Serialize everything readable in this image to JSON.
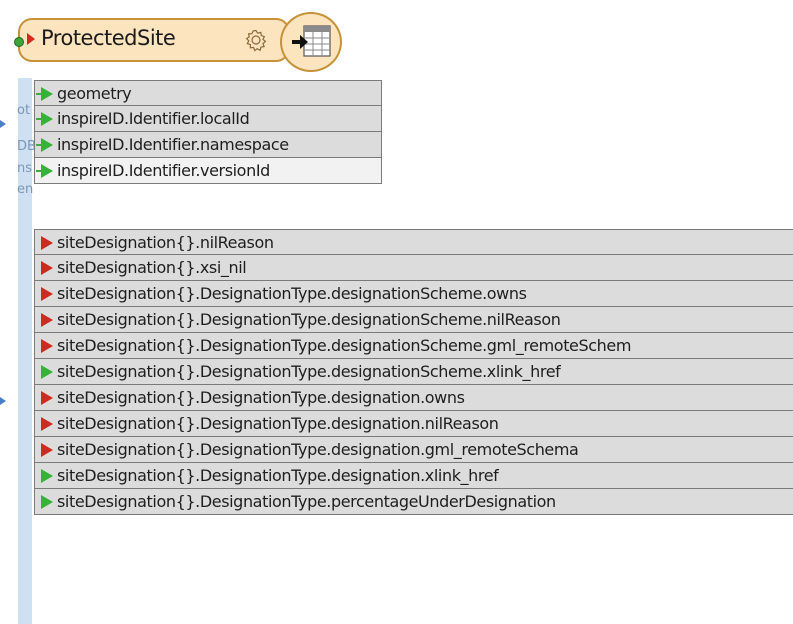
{
  "transformer": {
    "title": "ProtectedSite",
    "settings_icon": "gear-icon",
    "writer_icon": "table-writer-icon",
    "colors": {
      "header_fill": "#fce4bf",
      "header_border": "#c69238"
    }
  },
  "canvas_ghost_text": [
    "ot",
    "DB",
    "ns",
    "en"
  ],
  "top_attributes": [
    {
      "label": "geometry",
      "port": "green",
      "highlight": false
    },
    {
      "label": "inspireID.Identifier.localId",
      "port": "green",
      "highlight": false
    },
    {
      "label": "inspireID.Identifier.namespace",
      "port": "green",
      "highlight": false
    },
    {
      "label": "inspireID.Identifier.versionId",
      "port": "green",
      "highlight": true
    }
  ],
  "site_attributes": [
    {
      "label": "siteDesignation{}.nilReason",
      "port": "red"
    },
    {
      "label": "siteDesignation{}.xsi_nil",
      "port": "red"
    },
    {
      "label": "siteDesignation{}.DesignationType.designationScheme.owns",
      "port": "red"
    },
    {
      "label": "siteDesignation{}.DesignationType.designationScheme.nilReason",
      "port": "red"
    },
    {
      "label": "siteDesignation{}.DesignationType.designationScheme.gml_remoteSchem",
      "port": "red"
    },
    {
      "label": "siteDesignation{}.DesignationType.designationScheme.xlink_href",
      "port": "green"
    },
    {
      "label": "siteDesignation{}.DesignationType.designation.owns",
      "port": "red"
    },
    {
      "label": "siteDesignation{}.DesignationType.designation.nilReason",
      "port": "red"
    },
    {
      "label": "siteDesignation{}.DesignationType.designation.gml_remoteSchema",
      "port": "red"
    },
    {
      "label": "siteDesignation{}.DesignationType.designation.xlink_href",
      "port": "green"
    },
    {
      "label": "siteDesignation{}.DesignationType.percentageUnderDesignation",
      "port": "green"
    }
  ],
  "port_colors": {
    "green": "#39b03a",
    "red": "#cf2a20"
  }
}
